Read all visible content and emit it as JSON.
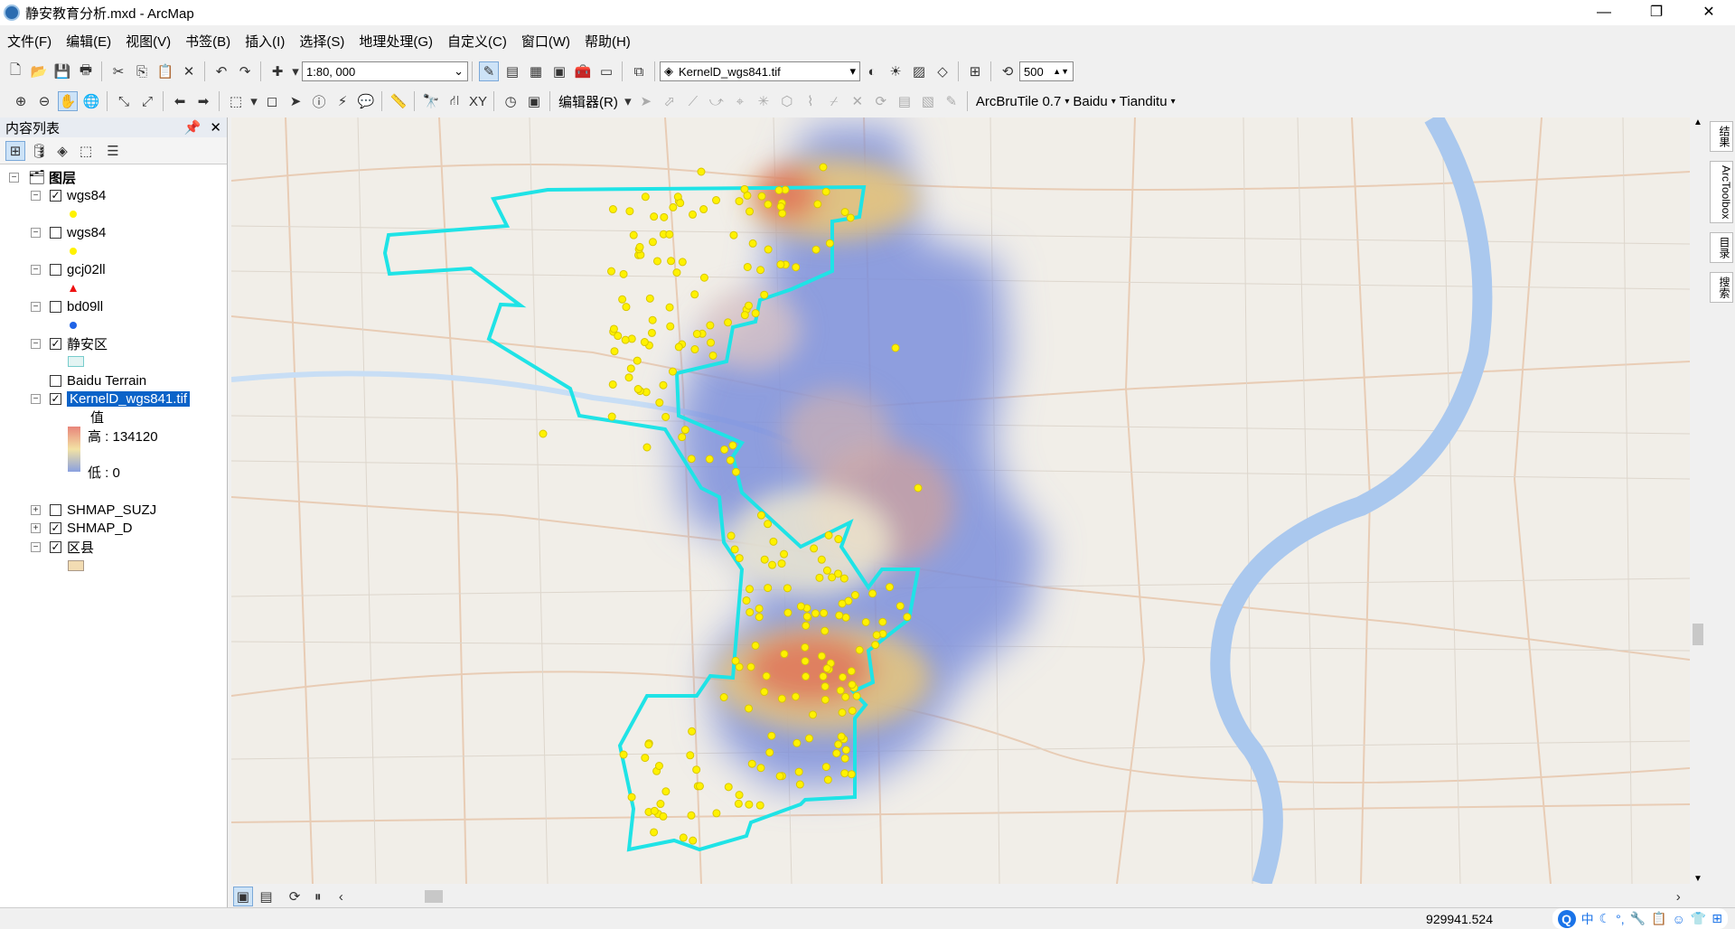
{
  "window": {
    "title": "静安教育分析.mxd - ArcMap",
    "minimize": "—",
    "maximize": "❐",
    "close": "✕"
  },
  "menu": [
    "文件(F)",
    "编辑(E)",
    "视图(V)",
    "书签(B)",
    "插入(I)",
    "选择(S)",
    "地理处理(G)",
    "自定义(C)",
    "窗口(W)",
    "帮助(H)"
  ],
  "toolbar": {
    "scale": "1:80, 000",
    "layer_combo": "KernelD_wgs841.tif",
    "buffer_value": "500",
    "editor_label": "编辑器(R)",
    "plugins": [
      "ArcBruTile 0.7",
      "Baidu",
      "Tianditu"
    ]
  },
  "toc": {
    "title": "内容列表",
    "root": "图层",
    "layers": [
      {
        "name": "wgs84",
        "checked": true
      },
      {
        "name": "wgs84",
        "checked": false
      },
      {
        "name": "gcj02ll",
        "checked": false
      },
      {
        "name": "bd09ll",
        "checked": false
      },
      {
        "name": "静安区",
        "checked": true
      },
      {
        "name": "Baidu Terrain",
        "checked": false
      },
      {
        "name": "KernelD_wgs841.tif",
        "checked": true
      },
      {
        "name": "SHMAP_SUZJ",
        "checked": false
      },
      {
        "name": "SHMAP_D",
        "checked": true
      },
      {
        "name": "区县",
        "checked": true
      }
    ],
    "legend": {
      "value_label": "值",
      "high": "高 : 134120",
      "low": "低 : 0"
    }
  },
  "right_tabs": [
    "结果",
    "ArcToolbox",
    "目录",
    "搜索"
  ],
  "status": {
    "coordinates": "929941.524"
  },
  "ime": {
    "lang": "中"
  },
  "colors": {
    "boundary": "#1fe3e6",
    "points": "#fff200",
    "density_low": "#7c8fdc",
    "density_high": "#e06b54"
  }
}
